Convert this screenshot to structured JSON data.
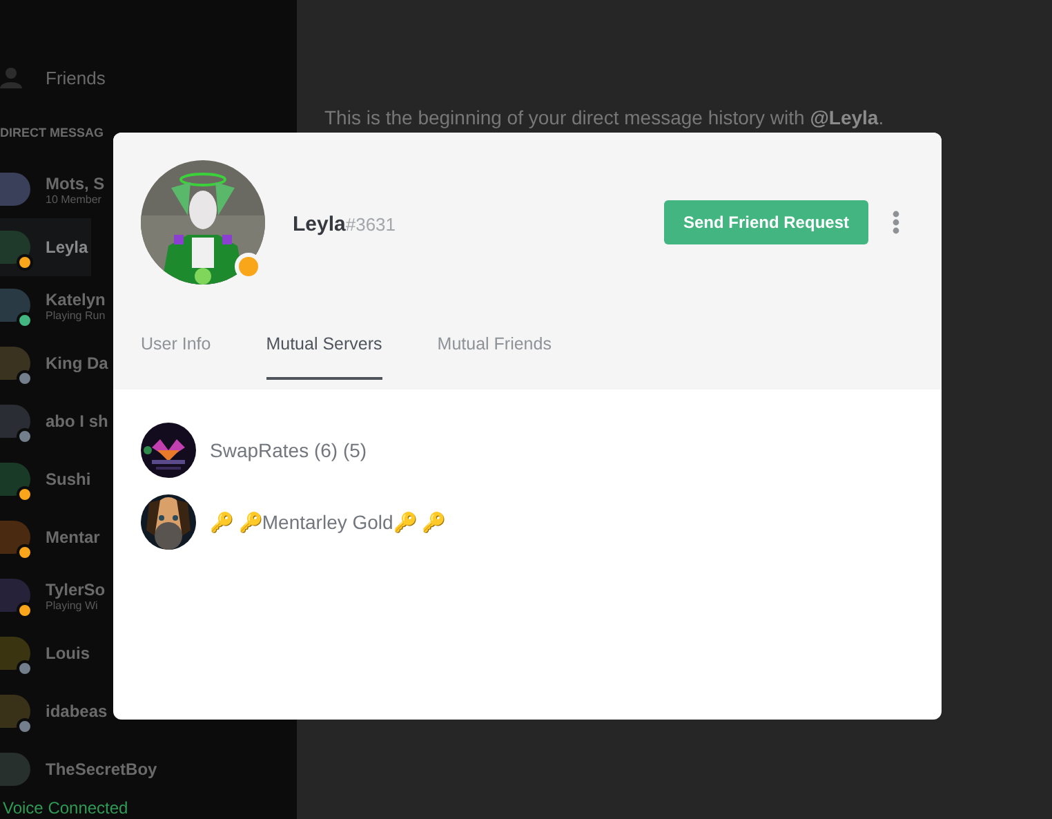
{
  "sidebar": {
    "friends_label": "Friends",
    "section_header": "DIRECT MESSAG",
    "items": [
      {
        "name": "Mots, S",
        "subtitle": "10 Member",
        "selected": false
      },
      {
        "name": "Leyla",
        "selected": true,
        "color": "#faa61a"
      },
      {
        "name": "Katelyn",
        "subtitle": "Playing Run",
        "selected": false,
        "color": "#43b581"
      },
      {
        "name": "King Da",
        "selected": false,
        "color": "#747f8d"
      },
      {
        "name": "abo I sh",
        "selected": false,
        "color": "#747f8d"
      },
      {
        "name": "Sushi",
        "selected": false,
        "color": "#faa61a"
      },
      {
        "name": "Mentar",
        "selected": false,
        "color": "#faa61a"
      },
      {
        "name": "TylerSo",
        "subtitle": "Playing Wi",
        "selected": false,
        "color": "#faa61a"
      },
      {
        "name": "Louis",
        "selected": false,
        "color": "#747f8d"
      },
      {
        "name": "idabeas",
        "selected": false,
        "color": "#747f8d"
      },
      {
        "name": "TheSecretBoy",
        "selected": false
      }
    ],
    "voice_status": "Voice Connected"
  },
  "main": {
    "intro": "This is the beginning of your direct message history with **@Leyla**."
  },
  "profile": {
    "username": "Leyla",
    "discriminator": "#3631",
    "color": "#faa61a",
    "action_button": "Send Friend Request",
    "tabs": [
      {
        "label": "User Info",
        "selected": false
      },
      {
        "label": "Mutual Servers",
        "selected": true
      },
      {
        "label": "Mutual Friends",
        "selected": false
      }
    ],
    "servers": [
      {
        "name": "SwapRates (6) (5)"
      },
      {
        "name": "🔑 🔑Mentarley Gold🔑 🔑"
      }
    ]
  }
}
